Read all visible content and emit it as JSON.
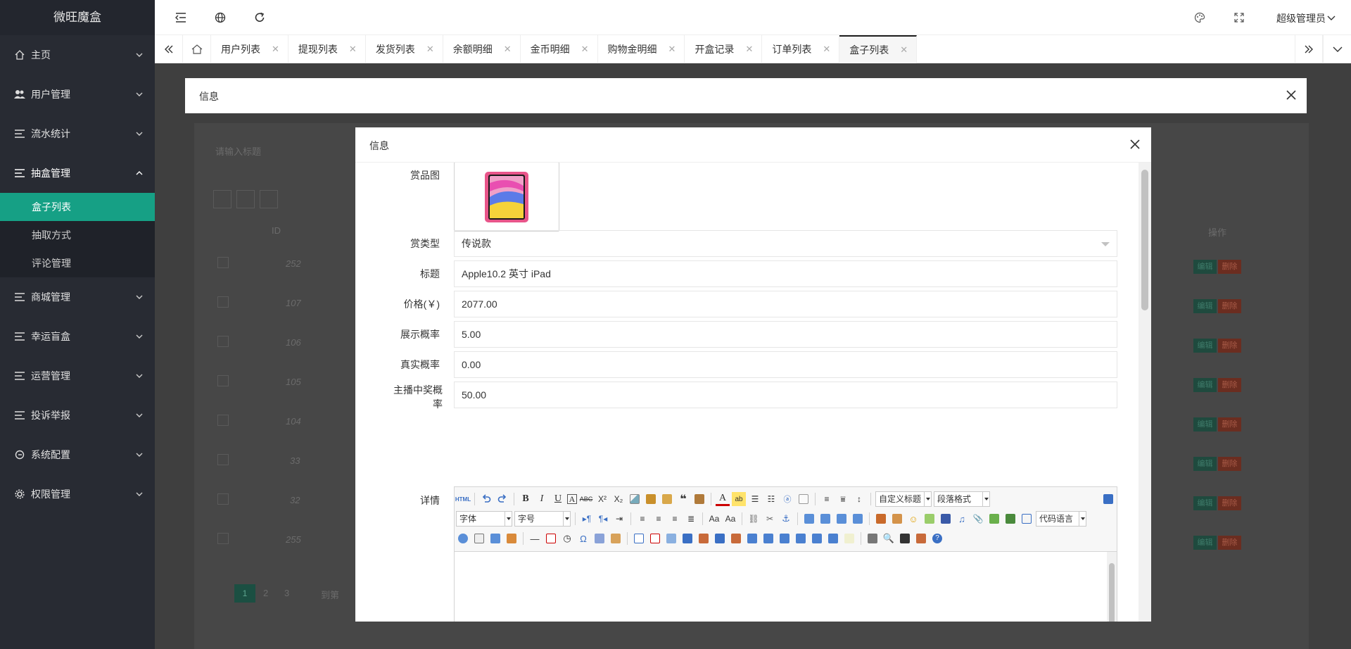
{
  "app": {
    "title": "微旺魔盒"
  },
  "sidebar": {
    "items": [
      {
        "label": "主页",
        "icon": "home-icon",
        "expanded": false
      },
      {
        "label": "用户管理",
        "icon": "users-icon",
        "expanded": false
      },
      {
        "label": "流水统计",
        "icon": "list-icon",
        "expanded": false
      },
      {
        "label": "抽盒管理",
        "icon": "list-icon",
        "expanded": true,
        "children": [
          {
            "label": "盒子列表",
            "active": true
          },
          {
            "label": "抽取方式",
            "active": false
          },
          {
            "label": "评论管理",
            "active": false
          }
        ]
      },
      {
        "label": "商城管理",
        "icon": "list-icon",
        "expanded": false
      },
      {
        "label": "幸运盲盒",
        "icon": "list-icon",
        "expanded": false
      },
      {
        "label": "运营管理",
        "icon": "list-icon",
        "expanded": false
      },
      {
        "label": "投诉举报",
        "icon": "list-icon",
        "expanded": false
      },
      {
        "label": "系统配置",
        "icon": "settings-circle-icon",
        "expanded": false
      },
      {
        "label": "权限管理",
        "icon": "gear-icon",
        "expanded": false
      }
    ]
  },
  "header": {
    "user": "超级管理员"
  },
  "tabs": [
    {
      "label": "用户列表",
      "active": false
    },
    {
      "label": "提现列表",
      "active": false
    },
    {
      "label": "发货列表",
      "active": false
    },
    {
      "label": "余额明细",
      "active": false
    },
    {
      "label": "金币明细",
      "active": false
    },
    {
      "label": "购物金明细",
      "active": false
    },
    {
      "label": "开盒记录",
      "active": false
    },
    {
      "label": "订单列表",
      "active": false
    },
    {
      "label": "盒子列表",
      "active": true
    }
  ],
  "background_page": {
    "search_placeholder": "请输入标题",
    "column_id": "ID",
    "column_action": "操作",
    "ids": [
      "252",
      "107",
      "106",
      "105",
      "104",
      "33",
      "32",
      "255"
    ],
    "edit_label": "编辑",
    "delete_label": "删除",
    "pagination": [
      "1",
      "2",
      "3"
    ],
    "goto_label": "到第"
  },
  "dialog_outer": {
    "title": "信息"
  },
  "dialog_inner": {
    "title": "信息",
    "fields": {
      "image_label": "赏品图",
      "type_label": "赏类型",
      "type_value": "传说款",
      "title_label": "标题",
      "title_value": "Apple10.2 英寸 iPad",
      "price_label": "价格(￥)",
      "price_value": "2077.00",
      "display_prob_label": "展示概率",
      "display_prob_value": "5.00",
      "real_prob_label": "真实概率",
      "real_prob_value": "0.00",
      "anchor_prob_label": "主播中奖概率",
      "anchor_prob_value": "50.00",
      "detail_label": "详情"
    },
    "editor": {
      "heading_combo": "自定义标题",
      "paragraph_combo": "段落格式",
      "font_combo": "字体",
      "size_combo": "字号",
      "code_combo": "代码语言"
    }
  }
}
